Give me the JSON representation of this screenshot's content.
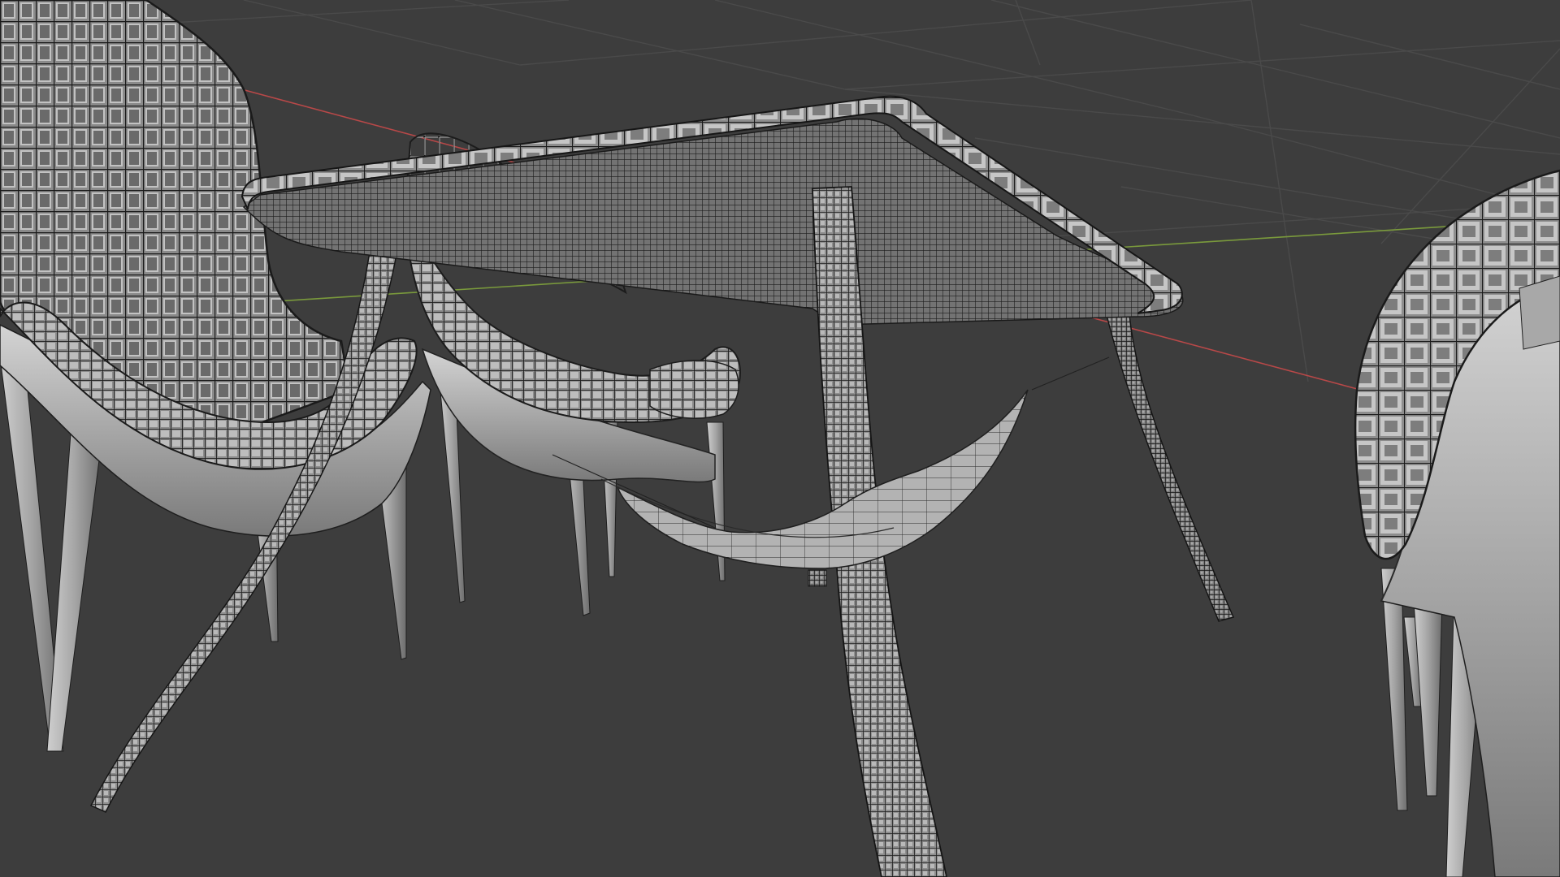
{
  "viewport": {
    "mode": "3d-viewport",
    "shading": "solid-wireframe-overlay",
    "colors": {
      "background": "#3d3d3d",
      "grid_line": "#4b4b4b",
      "x_axis": "#c24a4a",
      "y_axis": "#7e9b3e",
      "mesh_fill": "#9a9a9a",
      "mesh_light": "#c8c8c8",
      "mesh_dark": "#5a5a5a",
      "wire": "#1c1c1c"
    }
  },
  "scene": {
    "objects": [
      "table",
      "chair-left",
      "chair-back",
      "chair-right",
      "hanging-cloth"
    ]
  }
}
